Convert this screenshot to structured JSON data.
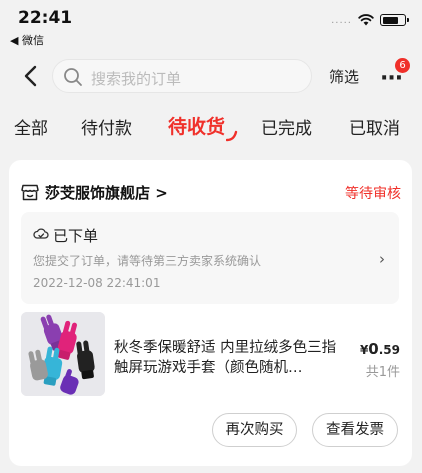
{
  "status_bar": {
    "time": "22:41",
    "back_app": "◀ 微信",
    "signal": "....."
  },
  "nav": {
    "search_placeholder": "搜索我的订单",
    "filter": "筛选",
    "badge_count": "6"
  },
  "tabs": [
    {
      "label": "全部"
    },
    {
      "label": "待付款"
    },
    {
      "label": "待收货",
      "active": true
    },
    {
      "label": "已完成"
    },
    {
      "label": "已取消"
    }
  ],
  "order": {
    "shop_name": "莎芠服饰旗舰店 >",
    "status": "等待审核",
    "logistics": {
      "title": "已下单",
      "description": "您提交了订单，请等待第三方卖家系统确认",
      "time": "2022-12-08 22:41:01"
    },
    "product": {
      "title": "秋冬季保暖舒适 内里拉绒多色三指触屏玩游戏手套（颜色随机…",
      "price_symbol": "¥",
      "price_int": "0",
      "price_dec": ".59",
      "quantity": "共1件"
    },
    "buttons": {
      "rebuy": "再次购买",
      "invoice": "查看发票"
    }
  },
  "colors": {
    "accent": "#f0302a",
    "background": "#f2f2f2"
  }
}
